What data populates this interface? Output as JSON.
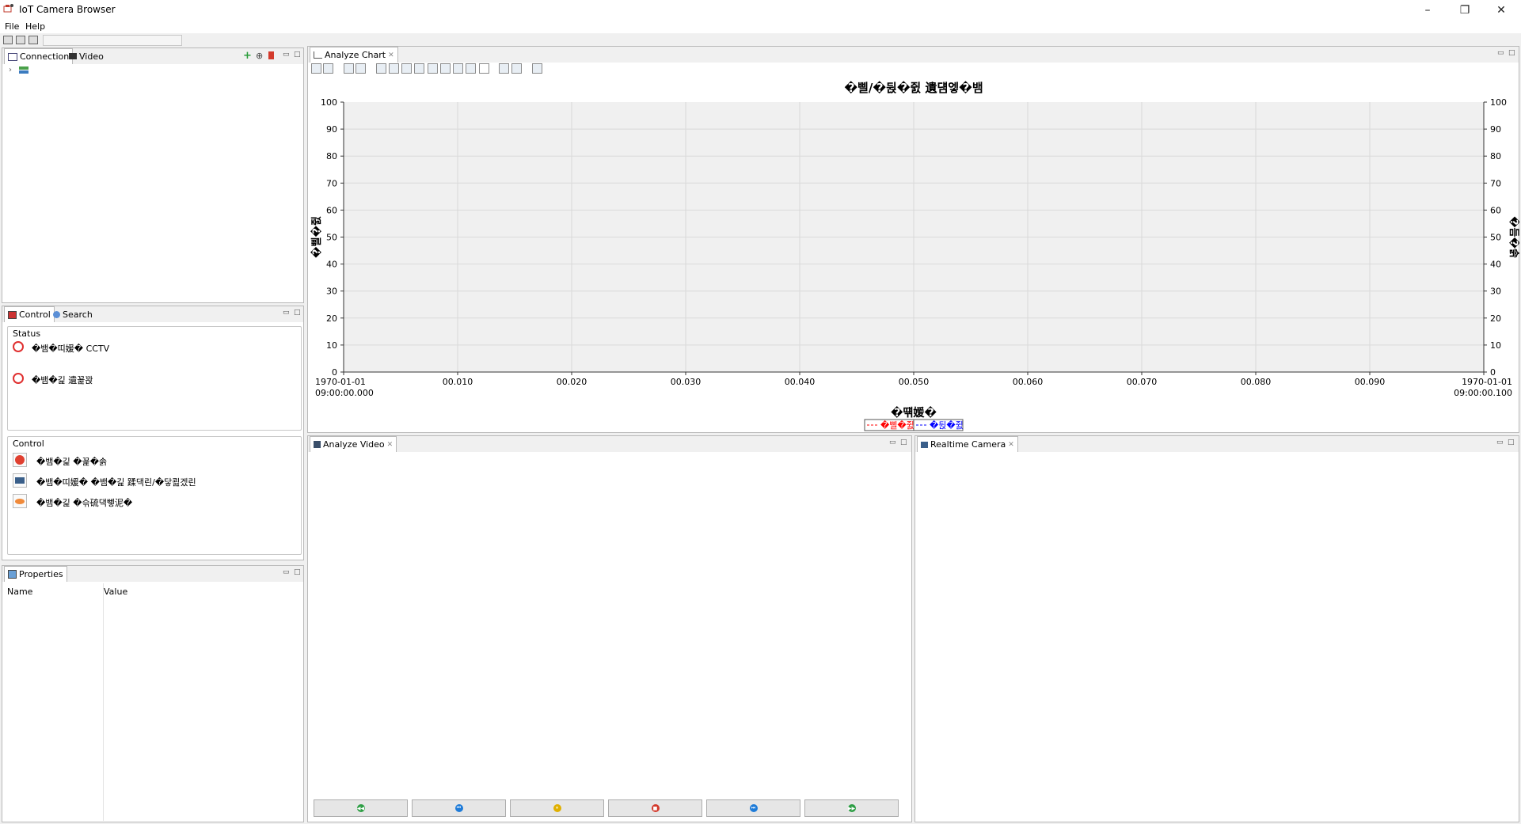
{
  "window": {
    "title": "IoT Camera Browser",
    "controls": {
      "minimize": "–",
      "restore": "❐",
      "close": "✕"
    }
  },
  "menu": [
    "File",
    "Help"
  ],
  "navigator": {
    "tabs": [
      "Connection",
      "Video"
    ]
  },
  "control_panel": {
    "tabs": [
      "Control",
      "Search"
    ],
    "status": {
      "title": "Status",
      "items": [
        "�뱀�띠媛� CCTV",
        "�뱀�긽 遺꾩꽍"
      ]
    },
    "control": {
      "title": "Control",
      "items": [
        "�뱀�긽 �꾩�솕",
        "�뱀�띠媛� �뱀�긽 蹂댁린/�닿쾶겠린",
        "�뱀�긽 �슦硫댁뼇泥�"
      ]
    }
  },
  "properties": {
    "title": "Properties",
    "columns": [
      "Name",
      "Value"
    ]
  },
  "analyze_chart": {
    "tab": "Analyze Chart",
    "colors": {
      "series1": "#ff0000",
      "series2": "#0000ff",
      "grid": "#d9d9d9",
      "plot_bg": "#f0f0f0"
    }
  },
  "chart_data": {
    "type": "line",
    "title": "�삘/�뒩�쥜 遺덈엫�뱀",
    "xlabel": "�떆媛�",
    "ylabel": "�삘�쥜",
    "ylabel_right": "�듬�솕",
    "xlim": [
      0,
      0.1
    ],
    "ylim": [
      0,
      100
    ],
    "x_ticks": [
      "1970-01-01\n09:00:00.000",
      "00.010",
      "00.020",
      "00.030",
      "00.040",
      "00.050",
      "00.060",
      "00.070",
      "00.080",
      "00.090",
      "1970-01-01\n09:00:00.100"
    ],
    "y_ticks": [
      "0",
      "10",
      "20",
      "30",
      "40",
      "50",
      "60",
      "70",
      "80",
      "90",
      "100"
    ],
    "grid": true,
    "legend_position": "bottom-center",
    "series": [
      {
        "name": "�삘�쥜",
        "color": "#ff0000",
        "x": [],
        "y": []
      },
      {
        "name": "�뒩�쥜",
        "color": "#0000ff",
        "x": [],
        "y": []
      }
    ]
  },
  "analyze_video": {
    "tab": "Analyze Video",
    "buttons": [
      {
        "name": "rewind-button",
        "icon": "rewind-icon",
        "color": "#2e9e45"
      },
      {
        "name": "prev-button",
        "icon": "prev-icon",
        "color": "#1e7bd8"
      },
      {
        "name": "pause-button",
        "icon": "pause-icon",
        "color": "#e0b000"
      },
      {
        "name": "stop-button",
        "icon": "stop-icon",
        "color": "#d33a2c"
      },
      {
        "name": "next-button",
        "icon": "next-icon",
        "color": "#1e7bd8"
      },
      {
        "name": "fast-forward-button",
        "icon": "fast-forward-icon",
        "color": "#2e9e45"
      }
    ]
  },
  "realtime_camera": {
    "tab": "Realtime Camera"
  }
}
